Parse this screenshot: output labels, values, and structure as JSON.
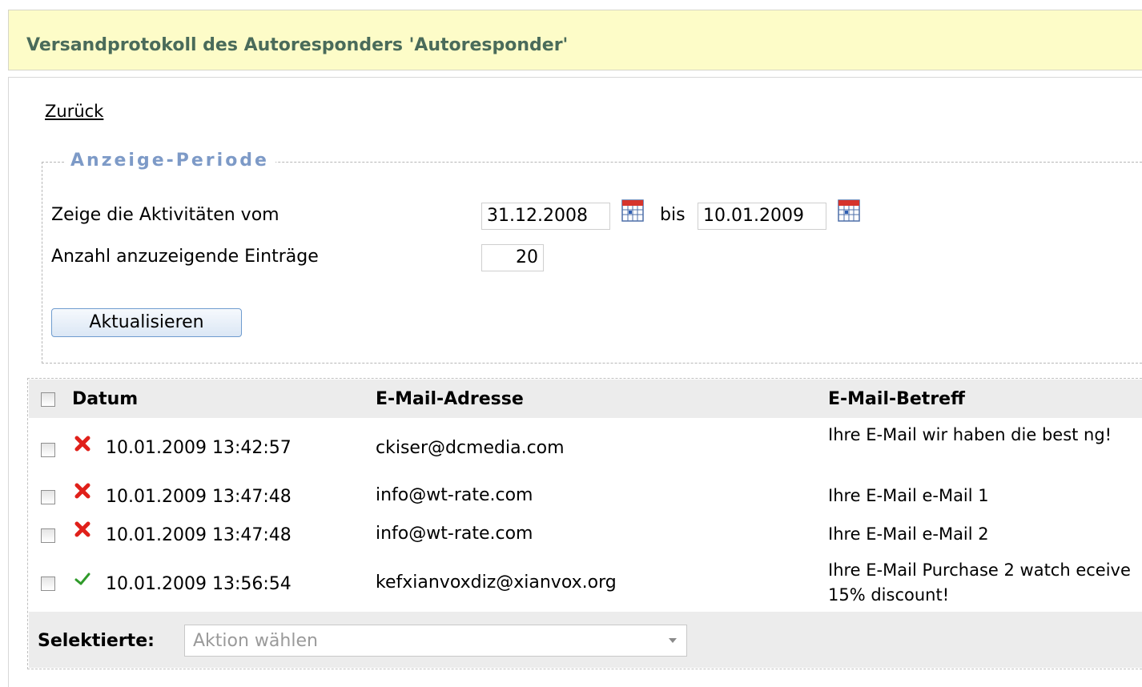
{
  "header": {
    "title": "Versandprotokoll des Autoresponders 'Autoresponder'"
  },
  "nav": {
    "back_label": "Zurück"
  },
  "period": {
    "legend": "Anzeige-Periode",
    "from_label": "Zeige die Aktivitäten vom",
    "from_value": "31.12.2008",
    "to_label": "bis",
    "to_value": "10.01.2009",
    "count_label": "Anzahl anzuzeigende Einträge",
    "count_value": "20",
    "update_label": "Aktualisieren"
  },
  "table": {
    "columns": [
      "Datum",
      "E-Mail-Adresse",
      "E-Mail-Betreff"
    ],
    "rows": [
      {
        "status": "error",
        "status_icon": "red-x-icon",
        "date": "10.01.2009 13:42:57",
        "email": "ckiser@dcmedia.com",
        "subject": "Ihre E-Mail wir haben die best ng!"
      },
      {
        "status": "error",
        "status_icon": "red-x-icon",
        "date": "10.01.2009 13:47:48",
        "email": "info@wt-rate.com",
        "subject": "Ihre E-Mail e-Mail 1"
      },
      {
        "status": "error",
        "status_icon": "red-x-icon",
        "date": "10.01.2009 13:47:48",
        "email": "info@wt-rate.com",
        "subject": "Ihre E-Mail e-Mail 2"
      },
      {
        "status": "success",
        "status_icon": "green-check-icon",
        "date": "10.01.2009 13:56:54",
        "email": "kefxianvoxdiz@xianvox.org",
        "subject": "Ihre E-Mail Purchase 2 watch eceive 15% discount!"
      }
    ]
  },
  "footer": {
    "selected_label": "Selektierte:",
    "action_placeholder": "Aktion wählen"
  },
  "colors": {
    "header_bg": "#fdfcc8",
    "header_text": "#4a6b5a",
    "legend_text": "#7d9ac7",
    "table_header_bg": "#ececec",
    "error_icon": "#e0201a",
    "success_icon": "#2f9a2a"
  }
}
